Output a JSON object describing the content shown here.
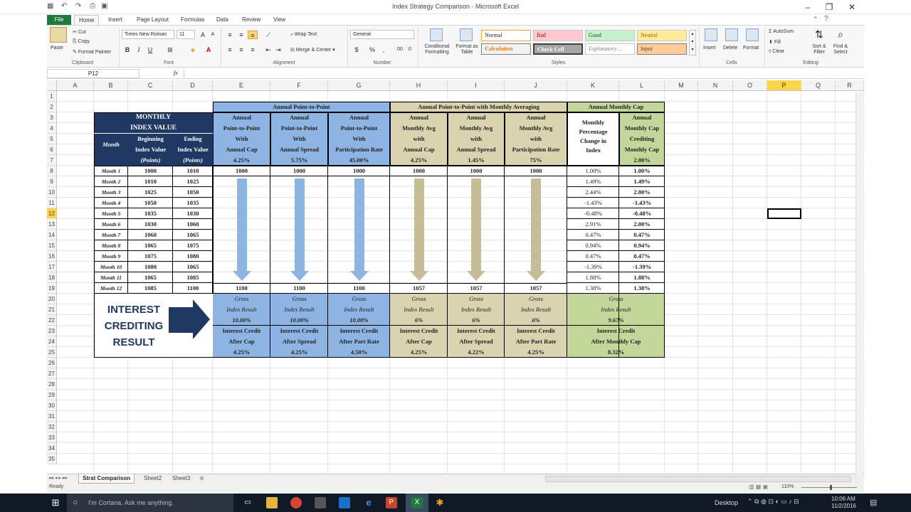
{
  "window": {
    "title": "Index Strategy Comparison - Microsoft Excel"
  },
  "tabs": [
    "File",
    "Home",
    "Insert",
    "Page Layout",
    "Formulas",
    "Data",
    "Review",
    "View"
  ],
  "ribbon": {
    "clipboard": {
      "paste": "Paste",
      "cut": "Cut",
      "copy": "Copy",
      "format_painter": "Format Painter",
      "label": "Clipboard"
    },
    "font": {
      "name": "Times New Roman",
      "size": "11",
      "label": "Font",
      "bold": "B",
      "italic": "I",
      "underline": "U"
    },
    "alignment": {
      "wrap": "Wrap Text",
      "merge": "Merge & Center",
      "label": "Alignment"
    },
    "number": {
      "format": "General",
      "currency": "$",
      "percent": "%",
      "comma": ",",
      "label": "Number"
    },
    "styles": {
      "conditional": "Conditional Formatting",
      "format_table": "Format as Table",
      "normal": "Normal",
      "bad": "Bad",
      "good": "Good",
      "neutral": "Neutral",
      "calculation": "Calculation",
      "check_cell": "Check Cell",
      "explanatory": "Explanatory ...",
      "input": "Input",
      "label": "Styles"
    },
    "cells": {
      "insert": "Insert",
      "delete": "Delete",
      "format": "Format",
      "label": "Cells"
    },
    "editing": {
      "autosum": "AutoSum",
      "fill": "Fill",
      "clear": "Clear",
      "sort": "Sort & Filter",
      "find": "Find & Select",
      "label": "Editing"
    }
  },
  "formula_bar": {
    "name_box": "P12",
    "fx": "fx",
    "value": ""
  },
  "columns": [
    "A",
    "B",
    "C",
    "D",
    "E",
    "F",
    "G",
    "H",
    "I",
    "J",
    "K",
    "L",
    "M",
    "N",
    "O",
    "P",
    "Q",
    "R"
  ],
  "rows": [
    "1",
    "2",
    "3",
    "4",
    "5",
    "6",
    "7",
    "8",
    "9",
    "10",
    "11",
    "12",
    "13",
    "14",
    "15",
    "16",
    "17",
    "18",
    "19",
    "20",
    "21",
    "22",
    "23",
    "24",
    "25",
    "26",
    "27",
    "28",
    "29",
    "30",
    "31",
    "32",
    "33",
    "34",
    "35"
  ],
  "table": {
    "left_header_title": [
      "MONTHLY",
      "INDEX VALUE"
    ],
    "hdr_month": "Month",
    "hdr_begin": [
      "Beginning",
      "Index Value",
      "(Points)"
    ],
    "hdr_end": [
      "Ending",
      "Index Value",
      "(Points)"
    ],
    "group_p2p": "Annual Point-to-Point",
    "group_avg": "Annual Point-to-Point with Monthly Averaging",
    "group_cap": "Annual Monthly Cap",
    "col_E": [
      "Annual",
      "Point-to-Point",
      "With",
      "Annual Cap",
      "4.25%"
    ],
    "col_F": [
      "Annual",
      "Point-to-Point",
      "With",
      "Annual Spread",
      "5.75%"
    ],
    "col_G": [
      "Annual",
      "Point-to-Point",
      "With",
      "Participation Rate",
      "45.00%"
    ],
    "col_H": [
      "Annual",
      "Monthly Avg",
      "with",
      "Annual Cap",
      "4.25%"
    ],
    "col_I": [
      "Annual",
      "Monthly Avg",
      "with",
      "Annual Spread",
      "1.45%"
    ],
    "col_J": [
      "Annual",
      "Monthly Avg",
      "with",
      "Participation Rate",
      "75%"
    ],
    "col_K": [
      "Monthly",
      "Percentage",
      "Change in",
      "Index"
    ],
    "col_L": [
      "Annual",
      "Monthly Cap",
      "Crediting",
      "Monthly Cap",
      "2.00%"
    ],
    "months": [
      "Month 1",
      "Month 2",
      "Month 3",
      "Month 4",
      "Month 5",
      "Month 6",
      "Month 7",
      "Month 8",
      "Month 9",
      "Month 10",
      "Month 11",
      "Month 12"
    ],
    "begin": [
      "1000",
      "1010",
      "1025",
      "1050",
      "1035",
      "1030",
      "1060",
      "1065",
      "1075",
      "1080",
      "1065",
      "1085"
    ],
    "end": [
      "1010",
      "1025",
      "1050",
      "1035",
      "1030",
      "1060",
      "1065",
      "1075",
      "1080",
      "1065",
      "1085",
      "1100"
    ],
    "monthly_change": [
      "1.00%",
      "1.49%",
      "2.44%",
      "-1.43%",
      "-0.48%",
      "2.91%",
      "0.47%",
      "0.94%",
      "0.47%",
      "-1.39%",
      "1.88%",
      "1.38%"
    ],
    "monthly_capped": [
      "1.00%",
      "1.49%",
      "2.00%",
      "-1.43%",
      "-0.48%",
      "2.00%",
      "0.47%",
      "0.94%",
      "0.47%",
      "-1.39%",
      "1.88%",
      "1.38%"
    ],
    "start_values": [
      "1000",
      "1000",
      "1000",
      "1000",
      "1000",
      "1000"
    ],
    "end_values": [
      "1100",
      "1100",
      "1100",
      "1057",
      "1057",
      "1057"
    ],
    "interest_label": [
      "INTEREST",
      "CREDITING",
      "RESULT"
    ],
    "gross": [
      [
        "Gross",
        "Index Result",
        "10.00%"
      ],
      [
        "Gross",
        "Index Result",
        "10.00%"
      ],
      [
        "Gross",
        "Index Result",
        "10.00%"
      ],
      [
        "Gross",
        "Index Result",
        "6%"
      ],
      [
        "Gross",
        "Index Result",
        "6%"
      ],
      [
        "Gross",
        "Index Result",
        "6%"
      ],
      [
        "Gross",
        "Index Result",
        "9.67%"
      ]
    ],
    "credit": [
      [
        "Interest Credit",
        "After Cap",
        "4.25%"
      ],
      [
        "Interest Credit",
        "After Spread",
        "4.25%"
      ],
      [
        "Interest Credit",
        "After Part Rate",
        "4.50%"
      ],
      [
        "Interest Credit",
        "After Cap",
        "4.25%"
      ],
      [
        "Interest Credit",
        "After Spread",
        "4.22%"
      ],
      [
        "Interest Credit",
        "After Part Rate",
        "4.25%"
      ],
      [
        "Interest Credit",
        "After Monthly Cap",
        "8.32%"
      ]
    ]
  },
  "sheet_tabs": [
    "Strat Comparison",
    "Sheet2",
    "Sheet3"
  ],
  "status": {
    "ready": "Ready",
    "zoom": "110%"
  },
  "taskbar": {
    "search": "I'm Cortana. Ask me anything.",
    "desktop": "Desktop",
    "time": "10:06 AM",
    "date": "11/2/2016"
  },
  "colors": {
    "blue_header": "#8db4e2",
    "tan_header": "#d9d3b0",
    "green_header": "#c4d79b",
    "navy": "#1f3864",
    "arrow_blue": "#8db4e2",
    "arrow_tan": "#c4bd97"
  }
}
